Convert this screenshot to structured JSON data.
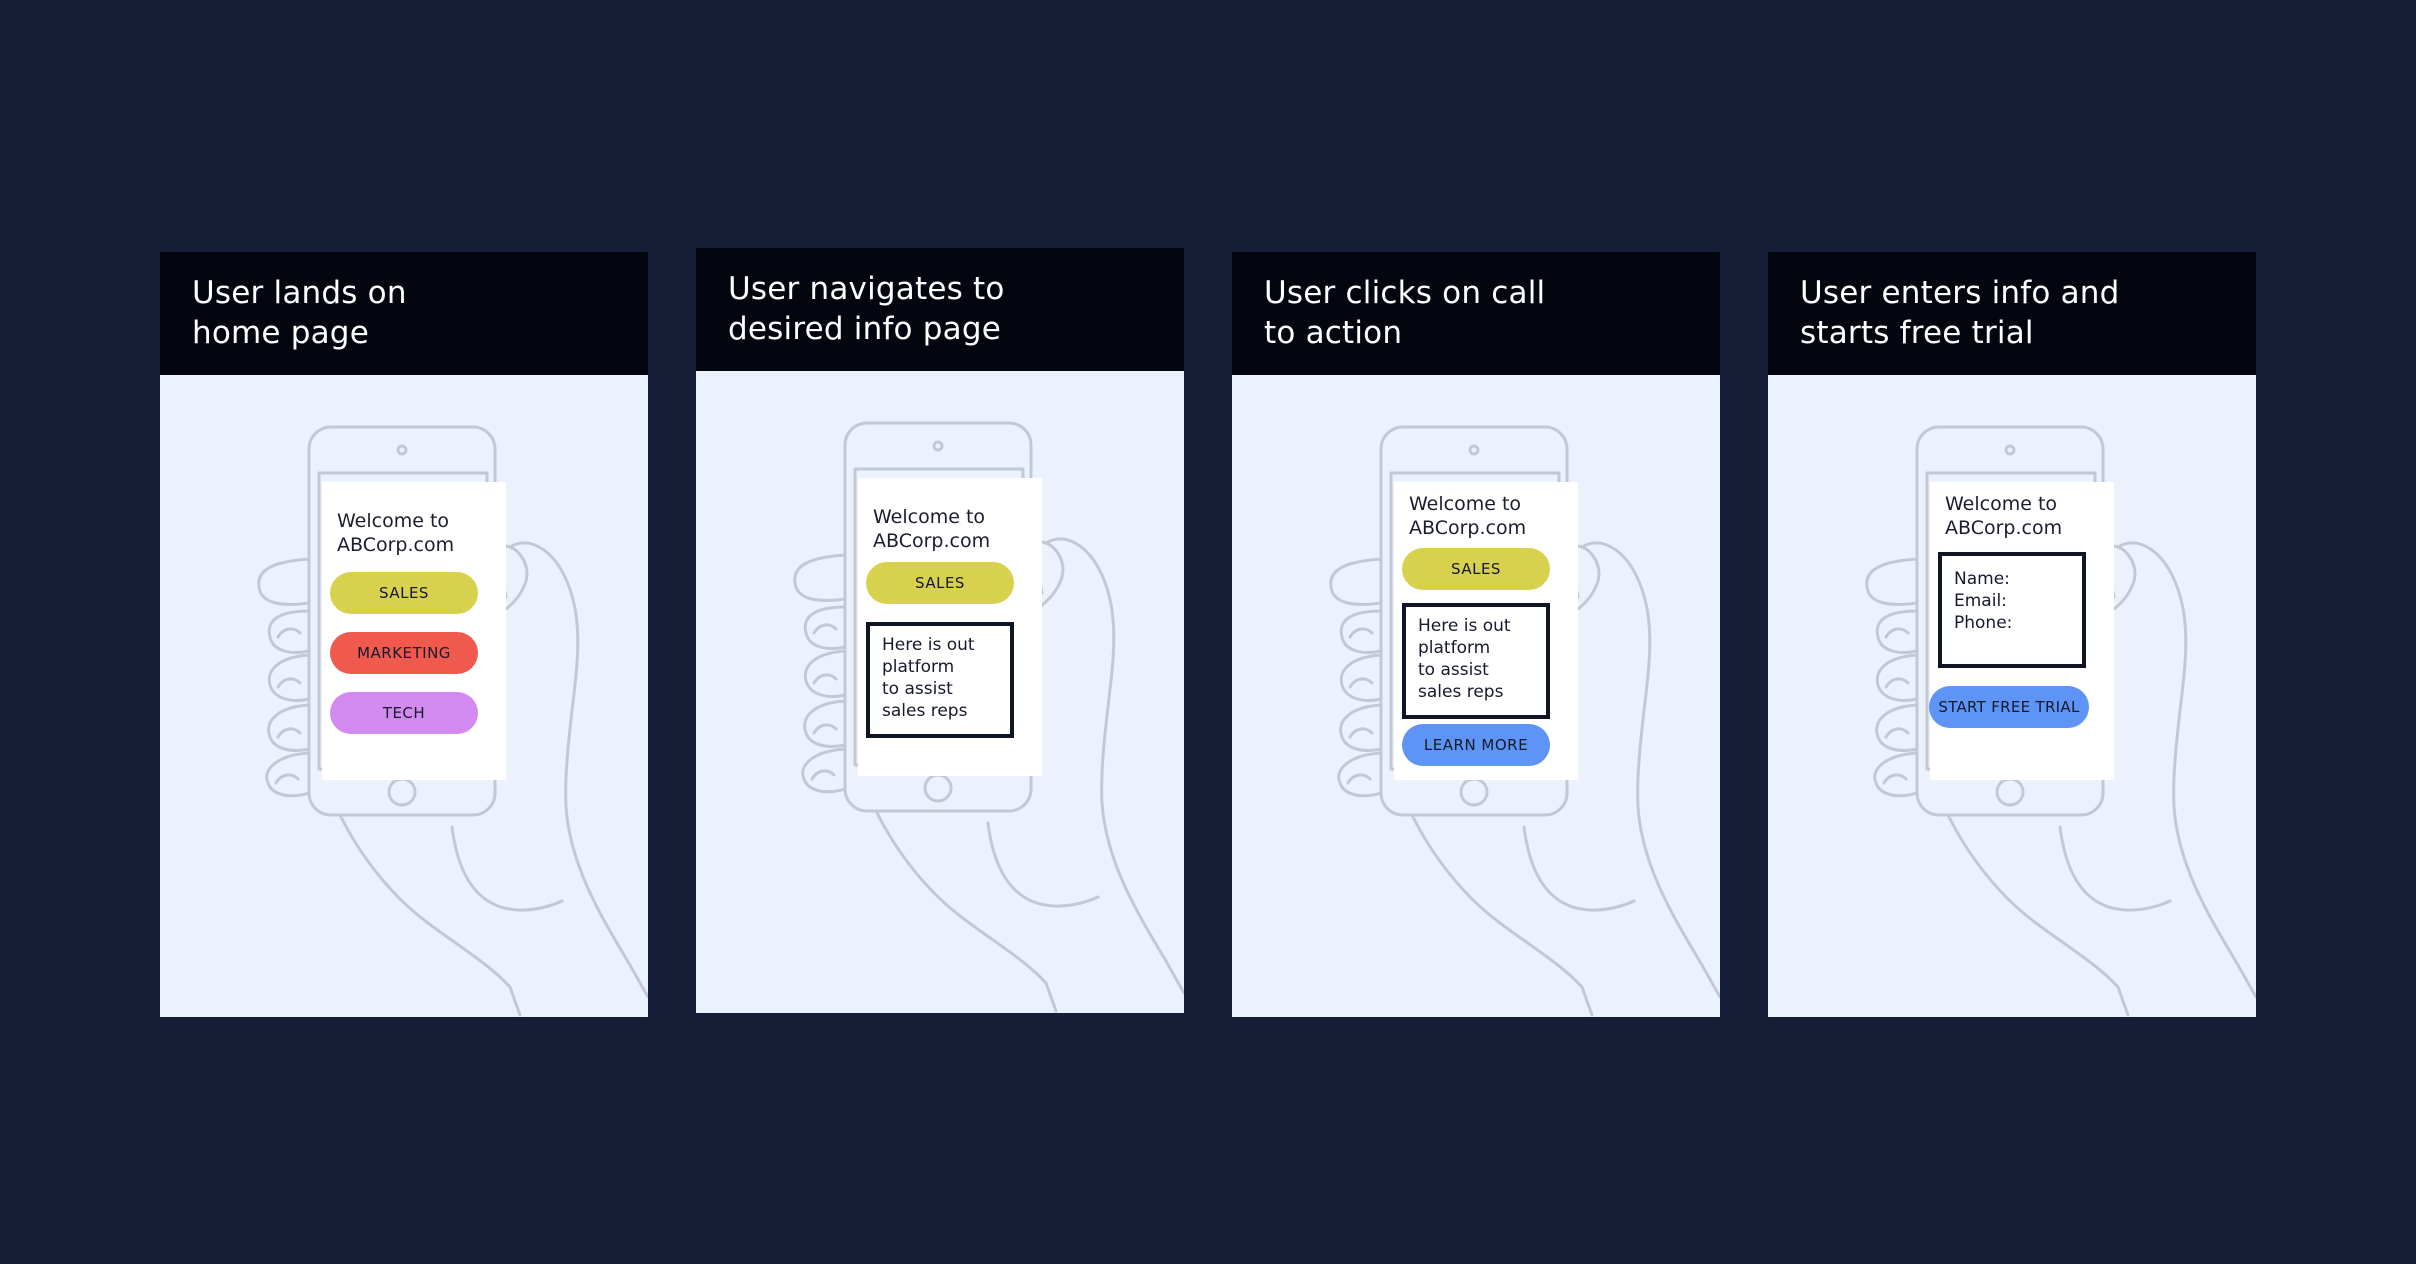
{
  "panels": [
    {
      "title_line1": "User lands on",
      "title_line2": "home page",
      "welcome_line1": "Welcome to",
      "welcome_line2": "ABCorp.com",
      "buttons": [
        {
          "label": "SALES",
          "color": "#d8d14d"
        },
        {
          "label": "MARKETING",
          "color": "#f05a4e"
        },
        {
          "label": "TECH",
          "color": "#d28af0"
        }
      ]
    },
    {
      "title_line1": "User navigates to",
      "title_line2": "desired info page",
      "welcome_line1": "Welcome to",
      "welcome_line2": "ABCorp.com",
      "buttons": [
        {
          "label": "SALES",
          "color": "#d8d14d"
        }
      ],
      "info_lines": [
        "Here is out",
        "platform",
        "to assist",
        "sales reps"
      ]
    },
    {
      "title_line1": "User clicks on call",
      "title_line2": "to action",
      "welcome_line1": "Welcome to",
      "welcome_line2": "ABCorp.com",
      "buttons": [
        {
          "label": "SALES",
          "color": "#d8d14d"
        }
      ],
      "info_lines": [
        "Here is out",
        "platform",
        "to assist",
        "sales reps"
      ],
      "cta": {
        "label": "LEARN MORE",
        "color": "#5d94f6"
      }
    },
    {
      "title_line1": "User enters info and",
      "title_line2": "starts free trial",
      "welcome_line1": "Welcome to",
      "welcome_line2": "ABCorp.com",
      "form_lines": [
        "Name:",
        "Email:",
        "Phone:"
      ],
      "cta": {
        "label": "START FREE TRIAL",
        "color": "#5d94f6"
      }
    }
  ],
  "colors": {
    "background": "#161d36",
    "panel": "#ebf2fd",
    "header": "#03060f",
    "outline": "#c3c8d4"
  }
}
